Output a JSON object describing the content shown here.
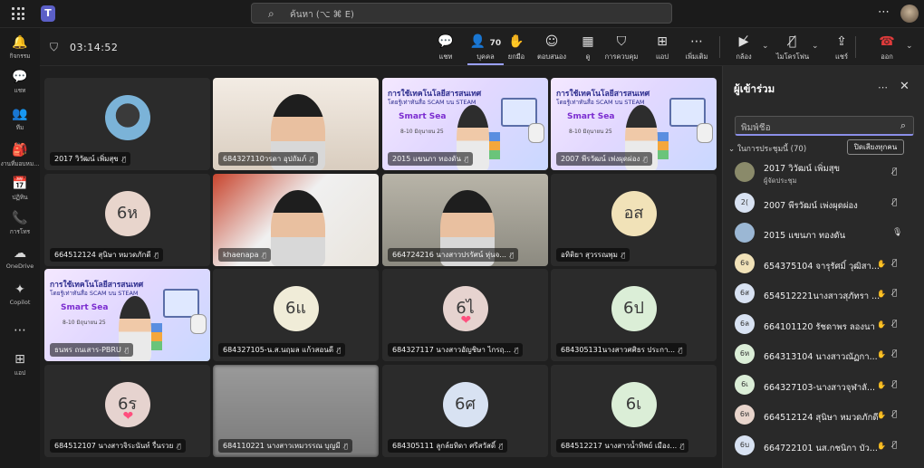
{
  "app": {
    "search_placeholder": "ค้นหา (⌥ ⌘ E)",
    "more": "⋯"
  },
  "rail": [
    {
      "icon": "bell-icon",
      "glyph": "🔔",
      "label": "กิจกรรม"
    },
    {
      "icon": "chat-icon",
      "glyph": "💬",
      "label": "แชท"
    },
    {
      "icon": "teams-icon",
      "glyph": "👥",
      "label": "ทีม"
    },
    {
      "icon": "assignments-icon",
      "glyph": "🎒",
      "label": "งานที่มอบหม..."
    },
    {
      "icon": "calendar-icon",
      "glyph": "📅",
      "label": "ปฏิทิน"
    },
    {
      "icon": "calls-icon",
      "glyph": "📞",
      "label": "การโทร"
    },
    {
      "icon": "onedrive-icon",
      "glyph": "☁",
      "label": "OneDrive"
    },
    {
      "icon": "copilot-icon",
      "glyph": "✦",
      "label": "Copilot"
    },
    {
      "icon": "more-apps-icon",
      "glyph": "⋯",
      "label": ""
    },
    {
      "icon": "add-apps-icon",
      "glyph": "⊞",
      "label": "แอป"
    }
  ],
  "meeting": {
    "timer": "03:14:52",
    "tools": [
      {
        "name": "chat",
        "icon": "chat-icon",
        "glyph": "💬",
        "label": "แชท"
      },
      {
        "name": "people",
        "icon": "people-icon",
        "glyph": "👤",
        "label": "บุคคล",
        "count": "70"
      },
      {
        "name": "raise-hand",
        "icon": "hand-icon",
        "glyph": "✋",
        "label": "ยกมือ"
      },
      {
        "name": "react",
        "icon": "smile-icon",
        "glyph": "☺",
        "label": "ตอบสนอง"
      },
      {
        "name": "view",
        "icon": "grid-icon",
        "glyph": "▦",
        "label": "ดู"
      },
      {
        "name": "controls",
        "icon": "shield-icon",
        "glyph": "⛉",
        "label": "การควบคุม"
      },
      {
        "name": "apps",
        "icon": "plus-box-icon",
        "glyph": "⊞",
        "label": "แอป"
      },
      {
        "name": "more",
        "icon": "more-icon",
        "glyph": "⋯",
        "label": "เพิ่มเติม"
      },
      {
        "name": "camera",
        "icon": "camera-off-icon",
        "glyph": "▶̸",
        "label": "กล้อง"
      },
      {
        "name": "mic",
        "icon": "mic-off-icon",
        "glyph": "🎙̸",
        "label": "ไมโครโฟน"
      },
      {
        "name": "share",
        "icon": "share-icon",
        "glyph": "⇪",
        "label": "แชร์"
      },
      {
        "name": "leave",
        "icon": "phone-hangup-icon",
        "glyph": "☎",
        "label": "ออก"
      }
    ]
  },
  "tiles": [
    {
      "label": "2017 วิวัฒน์ เพิ่มสุข",
      "type": "photo"
    },
    {
      "label": "684327110วรดา อุปถัมภ์",
      "type": "video"
    },
    {
      "label": "2015 แขนภา ทองดัน",
      "type": "slide"
    },
    {
      "label": "2007 พีรวัฒน์ เพ่งผุดผ่อง",
      "type": "slide"
    },
    {
      "label": "664512124 สุนิษา หมวดภักดี",
      "type": "avatar",
      "initials": "6ห",
      "color": "#e8d5cc"
    },
    {
      "label": "khaenapa",
      "type": "video"
    },
    {
      "label": "664724216 นางสาวปรรัศน์ หุ่นจ...",
      "type": "video"
    },
    {
      "label": "อทิติยา สุวรรณพุม",
      "type": "avatar",
      "initials": "อส",
      "color": "#f1e2b8"
    },
    {
      "label": "ธนพร ถนเสาร-PBRU",
      "type": "slide"
    },
    {
      "label": "684327105-น.ส.นฤมล แก้วสอนดี",
      "type": "avatar",
      "initials": "6แ",
      "color": "#f0ecd8"
    },
    {
      "label": "684327117 นางสาวอัญชิษา ไกรฤ...",
      "type": "avatar",
      "initials": "6ไ",
      "color": "#e6d3cf"
    },
    {
      "label": "684305131นางสาวศศิธร ประกา...",
      "type": "avatar",
      "initials": "6ป",
      "color": "#dbeed7"
    },
    {
      "label": "684512107 นางสาวจิระนันท์ รื่นรวย",
      "type": "avatar",
      "initials": "6ร",
      "color": "#e6d3cf"
    },
    {
      "label": "684110221 นางสาวเหมวรรณ บุญมี",
      "type": "blur"
    },
    {
      "label": "684305111 ลูกล์ยทิดา ศรีสวัสดิ์",
      "type": "avatar",
      "initials": "6ศ",
      "color": "#d8e2f2"
    },
    {
      "label": "684512217 นางสาวน้ำทิพย์ เมือง...",
      "type": "avatar",
      "initials": "6เ",
      "color": "#dbeed7"
    }
  ],
  "slide": {
    "title": "การใช้เทคโนโลยีสารสนเทศ",
    "subtitle": "โดยรู้เท่าทันสื่อ SCAM บน STEAM",
    "banner": "Smart Sea",
    "date": "8-10 มิถุนายน 25"
  },
  "panel": {
    "title": "ผู้เข้าร่วม",
    "search_placeholder": "พิมพ์ชื่อ",
    "section": "ในการประชุมนี้ (70)",
    "mute_all": "ปิดเสียงทุกคน",
    "participants": [
      {
        "name": "2017 วิวัฒน์ เพิ่มสุข",
        "role": "ผู้จัดประชุม",
        "initials": "",
        "color": "#8a8a6a",
        "hand": false,
        "mic": "off"
      },
      {
        "name": "2007 พีรวัฒน์ เพ่งผุดผ่อง",
        "role": "",
        "initials": "2(",
        "color": "#d8e2f2",
        "hand": false,
        "mic": "off"
      },
      {
        "name": "2015 แขนภา ทองดัน",
        "role": "",
        "initials": "",
        "color": "#9bb7d4",
        "hand": false,
        "mic": "on"
      },
      {
        "name": "654375104 จารุรัศมิ์ วุฒิสา...",
        "role": "",
        "initials": "6จ",
        "color": "#f1e2b8",
        "hand": true,
        "mic": "off"
      },
      {
        "name": "654512221นางสาวสุภัทรา ...",
        "role": "",
        "initials": "6ส",
        "color": "#d8e2f2",
        "hand": true,
        "mic": "off"
      },
      {
        "name": "664101120 รัชดาพร ลองนา",
        "role": "",
        "initials": "6ล",
        "color": "#d8e2f2",
        "hand": true,
        "mic": "off"
      },
      {
        "name": "664313104 นางสาวณัฏกา...",
        "role": "",
        "initials": "6ห",
        "color": "#dbeed7",
        "hand": true,
        "mic": "off"
      },
      {
        "name": "664327103-นางสาวจุฬาลั...",
        "role": "",
        "initials": "6เ",
        "color": "#dbeed7",
        "hand": true,
        "mic": "off"
      },
      {
        "name": "664512124 สุนิษา หมวดภักดี",
        "role": "",
        "initials": "6ห",
        "color": "#e8d5cc",
        "hand": true,
        "mic": "off"
      },
      {
        "name": "664722101 นส.กชนิกา บัว...",
        "role": "",
        "initials": "6บ",
        "color": "#d8e2f2",
        "hand": true,
        "mic": "off"
      }
    ]
  }
}
